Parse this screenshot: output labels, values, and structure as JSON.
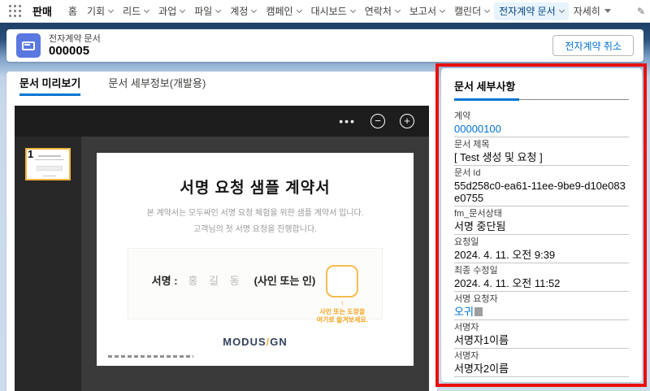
{
  "nav": {
    "app_name": "판매",
    "items": [
      {
        "label": "홈",
        "chevron": "none",
        "active": false
      },
      {
        "label": "기회",
        "chevron": "down",
        "active": false
      },
      {
        "label": "리드",
        "chevron": "down",
        "active": false
      },
      {
        "label": "과업",
        "chevron": "down",
        "active": false
      },
      {
        "label": "파일",
        "chevron": "down",
        "active": false
      },
      {
        "label": "계정",
        "chevron": "down",
        "active": false
      },
      {
        "label": "캠페인",
        "chevron": "down",
        "active": false
      },
      {
        "label": "대시보드",
        "chevron": "down",
        "active": false
      },
      {
        "label": "연락처",
        "chevron": "down",
        "active": false
      },
      {
        "label": "보고서",
        "chevron": "down",
        "active": false
      },
      {
        "label": "캘린더",
        "chevron": "down",
        "active": false
      },
      {
        "label": "전자계약 문서",
        "chevron": "down",
        "active": true
      },
      {
        "label": "자세히",
        "chevron": "caret",
        "active": false
      }
    ]
  },
  "header": {
    "record_type": "전자계약 문서",
    "record_name": "000005",
    "action_button": "전자계약 취소"
  },
  "tabs": {
    "preview": "문서 미리보기",
    "details_dev": "문서 세부정보(개발용)"
  },
  "preview": {
    "toolbar": {
      "more": "•••",
      "zoom_out": "−",
      "zoom_in": "+"
    },
    "page_number": "1",
    "doc": {
      "title": "서명 요청 샘플 계약서",
      "line1": "본 계약서는  모두싸인 서명 요청 체험을 위한 샘플 계약서 입니다.",
      "line2": "고객님의 첫 서명 요청을 진행합니다.",
      "sig_label": "서명 :",
      "sig_name": "홍 길 동",
      "sig_paren": "(사인 또는 인)",
      "hint_arrow": "↑",
      "hint_line1": "사인 또는 도장을",
      "hint_line2": "여기로 옮겨보세요.",
      "logo_part1": "MODUS",
      "logo_slash": "/",
      "logo_part2": "GN"
    }
  },
  "details": {
    "title": "문서 세부사항",
    "fields": [
      {
        "label": "계약",
        "value": "00000100",
        "link": true,
        "redacted": false
      },
      {
        "label": "문서 제목",
        "value": "[ Test 생성 및 요청 ]",
        "link": false,
        "redacted": false
      },
      {
        "label": "문서 Id",
        "value": "55d258c0-ea61-11ee-9be9-d10e083e0755",
        "link": false,
        "redacted": false
      },
      {
        "label": "fm_문서상태",
        "value": "서명 중단됨",
        "link": false,
        "redacted": false
      },
      {
        "label": "요청일",
        "value": "2024. 4. 11. 오전 9:39",
        "link": false,
        "redacted": false
      },
      {
        "label": "최종 수정일",
        "value": "2024. 4. 11. 오전 11:52",
        "link": false,
        "redacted": false
      },
      {
        "label": "서명 요청자",
        "value": "오귀",
        "link": true,
        "redacted": true
      },
      {
        "label": "서명자",
        "value": "서명자1이름",
        "link": false,
        "redacted": false
      },
      {
        "label": "서명자",
        "value": "서명자2이름",
        "link": false,
        "redacted": false
      }
    ]
  },
  "colors": {
    "accent_blue": "#0176d3",
    "link_blue": "#0070d2",
    "annotation_red": "#e8100c",
    "record_icon_blue": "#5a78e0",
    "stamp_yellow": "#f5bd4f",
    "hint_orange": "#f5a623",
    "logo_navy": "#33415e",
    "header_band_navy": "#1e4066",
    "page_bg_blue": "#ccdbee"
  }
}
